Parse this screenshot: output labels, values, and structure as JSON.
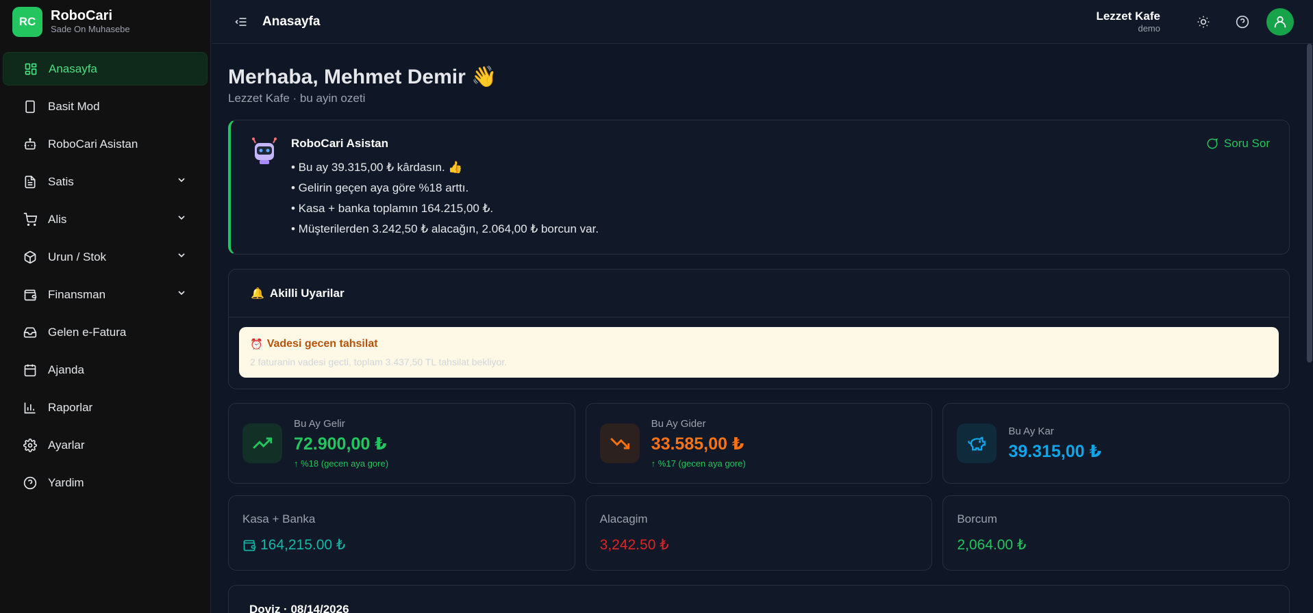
{
  "brand": {
    "logo": "RC",
    "name": "RoboCari",
    "subtitle": "Sade On Muhasebe"
  },
  "sidebar": {
    "items": [
      {
        "label": "Anasayfa",
        "icon": "dashboard-icon",
        "active": true
      },
      {
        "label": "Basit Mod",
        "icon": "tablet-icon"
      },
      {
        "label": "RoboCari Asistan",
        "icon": "bot-icon"
      },
      {
        "label": "Satis",
        "icon": "file-icon",
        "expandable": true
      },
      {
        "label": "Alis",
        "icon": "cart-icon",
        "expandable": true
      },
      {
        "label": "Urun / Stok",
        "icon": "box-icon",
        "expandable": true
      },
      {
        "label": "Finansman",
        "icon": "wallet-icon",
        "expandable": true
      },
      {
        "label": "Gelen e-Fatura",
        "icon": "inbox-icon"
      },
      {
        "label": "Ajanda",
        "icon": "calendar-icon"
      },
      {
        "label": "Raporlar",
        "icon": "bar-chart-icon"
      },
      {
        "label": "Ayarlar",
        "icon": "gear-icon"
      },
      {
        "label": "Yardim",
        "icon": "help-icon"
      }
    ]
  },
  "header": {
    "title": "Anasayfa",
    "company_name": "Lezzet Kafe",
    "company_user": "demo"
  },
  "greeting": {
    "title": "Merhaba, Mehmet Demir 👋",
    "subtitle": "Lezzet Kafe · bu ayin ozeti"
  },
  "assistant": {
    "title": "RoboCari Asistan",
    "ask_label": "Soru Sor",
    "lines": [
      "• Bu ay 39.315,00 ₺ kârdasın. 👍",
      "• Gelirin geçen aya göre %18 arttı.",
      "• Kasa + banka toplamın 164.215,00 ₺.",
      "• Müşterilerden 3.242,50 ₺ alacağın, 2.064,00 ₺ borcun var."
    ]
  },
  "alerts": {
    "title": "Akilli Uyarilar",
    "items": [
      {
        "title": "Vadesi gecen tahsilat",
        "description": "2 faturanin vadesi gecti, toplam 3.437,50 TL tahsilat bekliyor."
      }
    ]
  },
  "stats": [
    {
      "label": "Bu Ay Gelir",
      "value": "72.900,00 ₺",
      "change": "↑ %18 (gecen aya gore)",
      "color": "#22c55e"
    },
    {
      "label": "Bu Ay Gider",
      "value": "33.585,00 ₺",
      "change": "↑ %17 (gecen aya gore)",
      "color": "#f97316"
    },
    {
      "label": "Bu Ay Kar",
      "value": "39.315,00 ₺",
      "change": "",
      "color": "#0ea5e9"
    }
  ],
  "balances": [
    {
      "label": "Kasa + Banka",
      "value": "164,215.00 ₺",
      "color": "#14b8a6"
    },
    {
      "label": "Alacagim",
      "value": "3,242.50 ₺",
      "color": "#dc2626"
    },
    {
      "label": "Borcum",
      "value": "2,064.00 ₺",
      "color": "#22c55e"
    }
  ],
  "doviz": {
    "title": "Doviz · 08/14/2026"
  }
}
